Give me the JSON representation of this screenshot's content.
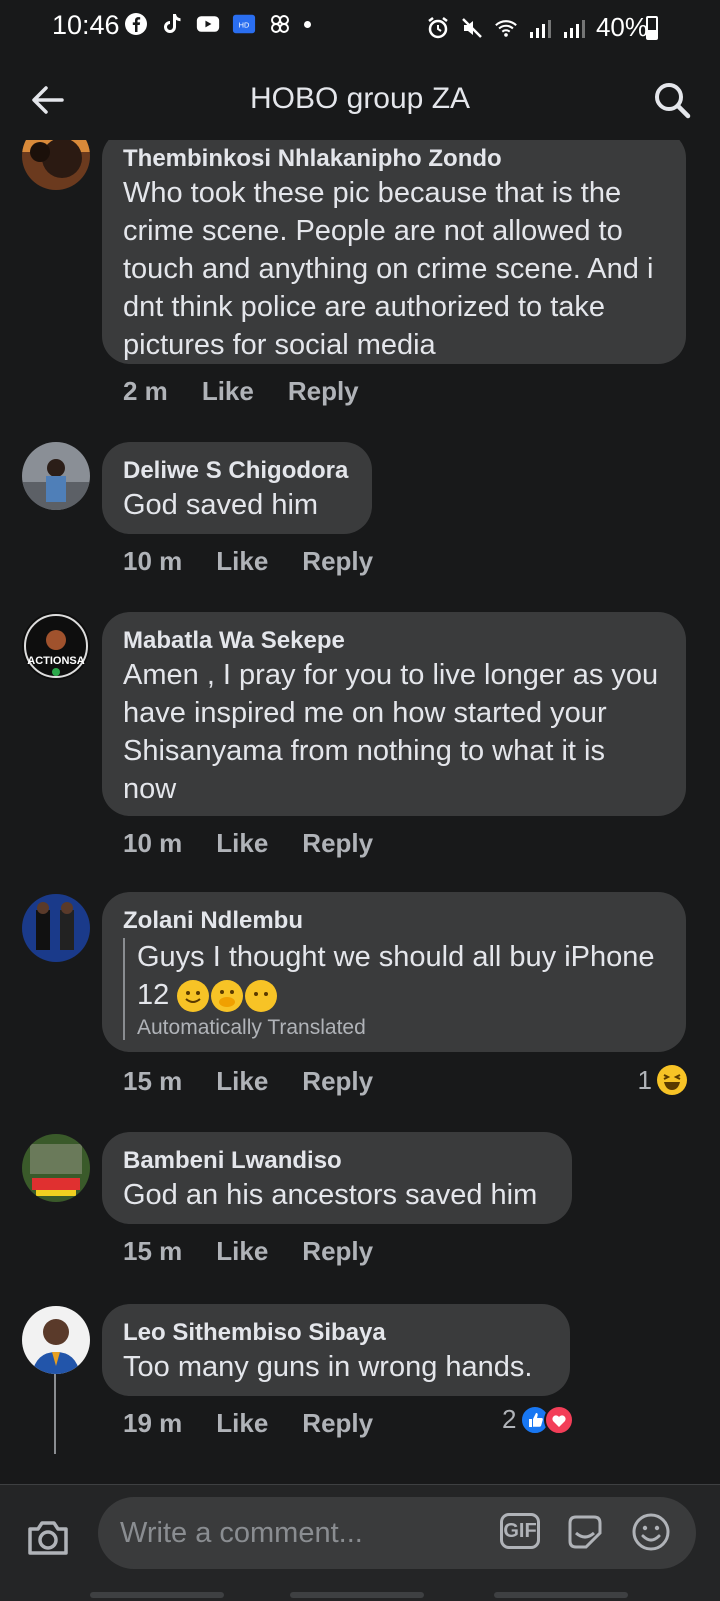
{
  "status_bar": {
    "time": "10:46",
    "battery": "40%"
  },
  "header": {
    "title": "HOBO group ZA"
  },
  "comments": [
    {
      "author": "Thembinkosi Nhlakanipho Zondo",
      "text": "Who took these pic because that is the crime scene. People are not allowed to touch and anything on crime scene. And i dnt think police are authorized to take pictures for social media",
      "time": "2 m",
      "like": "Like",
      "reply": "Reply"
    },
    {
      "author": "Deliwe S Chigodora",
      "text": "God saved him",
      "time": "10 m",
      "like": "Like",
      "reply": "Reply"
    },
    {
      "author": "Mabatla Wa Sekepe",
      "text": "Amen , I pray for you to live longer as you have inspired me on how started your Shisanyama from nothing to what it is now",
      "time": "10 m",
      "like": "Like",
      "reply": "Reply",
      "avatar_label": "ACTIONSA"
    },
    {
      "author": "Zolani Ndlembu",
      "text": "Guys I thought we should all buy iPhone 12",
      "translated_label": "Automatically Translated",
      "time": "15 m",
      "like": "Like",
      "reply": "Reply",
      "reaction_count": "1"
    },
    {
      "author": "Bambeni Lwandiso",
      "text": "God an his ancestors saved him",
      "time": "15 m",
      "like": "Like",
      "reply": "Reply"
    },
    {
      "author": "Leo Sithembiso Sibaya",
      "text": "Too many guns in wrong hands.",
      "time": "19 m",
      "like": "Like",
      "reply": "Reply",
      "reaction_count": "2"
    }
  ],
  "composer": {
    "placeholder": "Write a comment...",
    "gif_label": "GIF"
  },
  "colors": {
    "background": "#18191a",
    "bubble": "#3a3b3c",
    "like_blue": "#1877f2",
    "love_red": "#f33e58",
    "haha_yellow": "#f7c326"
  }
}
